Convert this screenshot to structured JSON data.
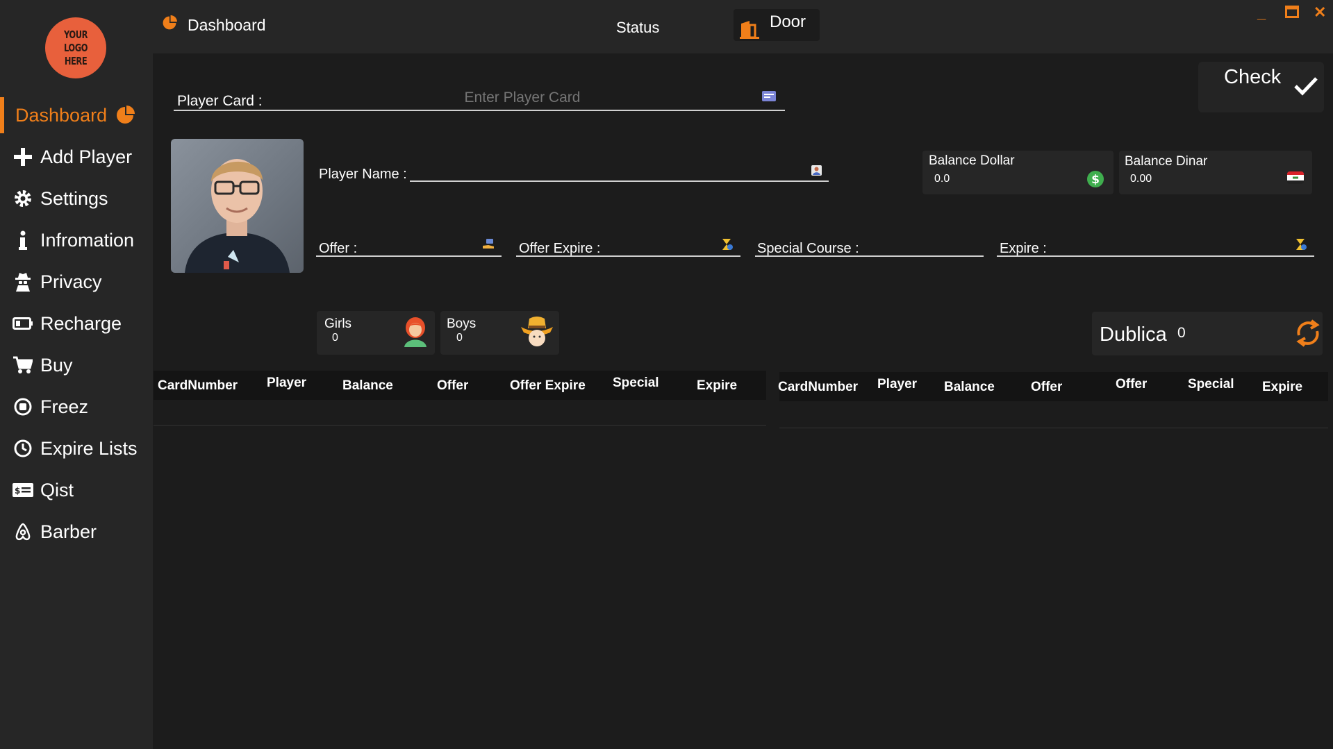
{
  "logo": {
    "text": "YOUR\nLOGO\nHERE"
  },
  "sidebar": {
    "items": [
      {
        "label": "Dashboard",
        "icon": "pie-chart-icon",
        "active": true
      },
      {
        "label": "Add Player",
        "icon": "plus-icon"
      },
      {
        "label": "Settings",
        "icon": "gear-icon"
      },
      {
        "label": "Infromation",
        "icon": "info-icon"
      },
      {
        "label": "Privacy",
        "icon": "spy-icon"
      },
      {
        "label": "Recharge",
        "icon": "battery-icon"
      },
      {
        "label": "Buy",
        "icon": "cart-icon"
      },
      {
        "label": "Freez",
        "icon": "stop-circle-icon"
      },
      {
        "label": "Expire Lists",
        "icon": "clock-icon"
      },
      {
        "label": "Qist",
        "icon": "money-card-icon"
      },
      {
        "label": "Barber",
        "icon": "airbnb-icon"
      }
    ]
  },
  "header": {
    "title": "Dashboard",
    "status": "Status",
    "door": "Door"
  },
  "window_controls": {
    "minimize": "_",
    "maximize": "☐",
    "close": "✕"
  },
  "check_button": {
    "label": "Check"
  },
  "player_card": {
    "label": "Player Card :",
    "placeholder": "Enter Player Card"
  },
  "player_name": {
    "label": "Player Name :"
  },
  "balance_dollar": {
    "label": "Balance Dollar",
    "value": "0.0"
  },
  "balance_dinar": {
    "label": "Balance Dinar",
    "value": "0.00"
  },
  "offer": {
    "label": "Offer :"
  },
  "offer_expire": {
    "label": "Offer Expire :"
  },
  "special_course": {
    "label": "Special Course :"
  },
  "expire": {
    "label": "Expire :"
  },
  "girls": {
    "label": "Girls",
    "value": "0"
  },
  "boys": {
    "label": "Boys",
    "value": "0"
  },
  "dublica": {
    "label": "Dublica",
    "value": "0"
  },
  "table_left": {
    "columns": [
      "CardNumber",
      "Player",
      "Balance",
      "Offer",
      "Offer Expire",
      "Special",
      "Expire"
    ]
  },
  "table_right": {
    "columns": [
      "CardNumber",
      "Player",
      "Balance",
      "Offer",
      "Offer",
      "Special",
      "Expire"
    ]
  },
  "colors": {
    "accent": "#f07f1a",
    "sidebar_bg": "#262626",
    "main_bg": "#1c1c1c"
  }
}
